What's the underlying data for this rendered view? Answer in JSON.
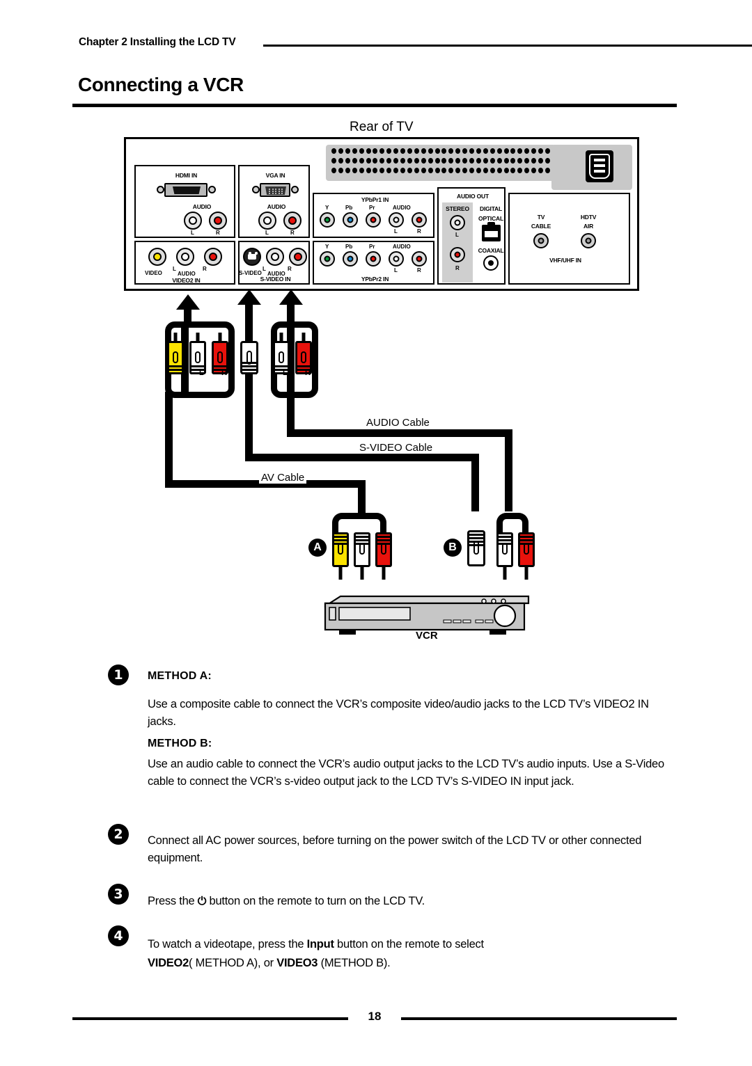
{
  "header": {
    "chapter": "Chapter 2 Installing the LCD TV",
    "title": "Connecting a VCR"
  },
  "diagram": {
    "rear_label": "Rear of TV",
    "vcr_label": "VCR",
    "marker_a": "A",
    "marker_b": "B",
    "cables": {
      "audio": "AUDIO Cable",
      "svideo": "S-VIDEO Cable",
      "av": "AV Cable"
    },
    "plug_labels": {
      "left": "L",
      "right": "R"
    },
    "panel": {
      "hdmi": {
        "title": "HDMI IN",
        "audio": "AUDIO",
        "l": "L",
        "r": "R"
      },
      "vga": {
        "title": "VGA IN",
        "audio": "AUDIO",
        "l": "L",
        "r": "R"
      },
      "video2": {
        "title": "VIDEO2 IN",
        "video": "VIDEO",
        "audio": "AUDIO",
        "l": "L",
        "r": "R"
      },
      "svideo": {
        "title": "S-VIDEO IN",
        "svideo": "S-VIDEO",
        "audio": "AUDIO",
        "l": "L",
        "r": "R"
      },
      "ypbpr1": {
        "title": "YPbPr1 IN",
        "y": "Y",
        "pb": "Pb",
        "pr": "Pr",
        "audio": "AUDIO",
        "l": "L",
        "r": "R"
      },
      "ypbpr2": {
        "title": "YPbPr2 IN",
        "y": "Y",
        "pb": "Pb",
        "pr": "Pr",
        "audio": "AUDIO",
        "l": "L",
        "r": "R"
      },
      "audio_out": {
        "title": "AUDIO OUT",
        "stereo": "STEREO",
        "stereo_l": "L",
        "stereo_r": "R",
        "digital": "DIGITAL",
        "optical": "OPTICAL",
        "coaxial": "COAXIAL"
      },
      "antenna": {
        "tv": "TV",
        "cable": "CABLE",
        "hdtv": "HDTV",
        "air": "AIR",
        "title": "VHF/UHF IN"
      }
    }
  },
  "steps": {
    "one": {
      "num": "1",
      "method_a_label": "METHOD A:",
      "method_a_text": "Use a composite cable to connect the VCR’s composite video/audio jacks to the LCD TV’s VIDEO2 IN jacks.",
      "method_b_label": "METHOD B:",
      "method_b_text": "Use an audio cable to connect the VCR’s audio output jacks to the LCD TV’s audio inputs. Use a S-Video cable to connect the VCR’s s-video output jack to the LCD TV’s S-VIDEO IN input jack."
    },
    "two": {
      "num": "2",
      "text": "Connect all AC power sources, before turning on the power switch of the LCD TV or other connected equipment."
    },
    "three": {
      "num": "3",
      "text_before": "Press the ",
      "power_icon": "⏻",
      "text_after": " button on the remote to turn on the LCD TV."
    },
    "four": {
      "num": "4",
      "line1_a": "To watch a videotape, press the ",
      "line1_b": "Input",
      "line1_c": " button on the remote to select",
      "line2_a": "VIDEO2",
      "line2_b": "( METHOD A), or ",
      "line2_c": "VIDEO3",
      "line2_d": " (METHOD B)."
    }
  },
  "footer": {
    "page_number": "18"
  }
}
